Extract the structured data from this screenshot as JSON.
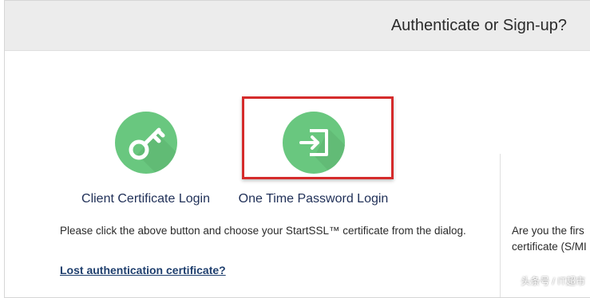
{
  "header": {
    "title": "Authenticate or Sign-up?"
  },
  "options": [
    {
      "label": "Client Certificate Login",
      "icon": "key-icon"
    },
    {
      "label": "One Time Password Login",
      "icon": "sign-in-icon",
      "highlighted": true
    }
  ],
  "instructions": "Please click the above button and choose your StartSSL™ certificate from the dialog.",
  "lost_link": "Lost authentication certificate?",
  "right_panel": {
    "line1": "Are you the firs",
    "line2": "certificate (S/MI"
  },
  "watermark": "头条号 / IT超市",
  "colors": {
    "icon_green": "#69c77f",
    "highlight_red": "#d52b2b",
    "link": "#1f3f6e"
  }
}
